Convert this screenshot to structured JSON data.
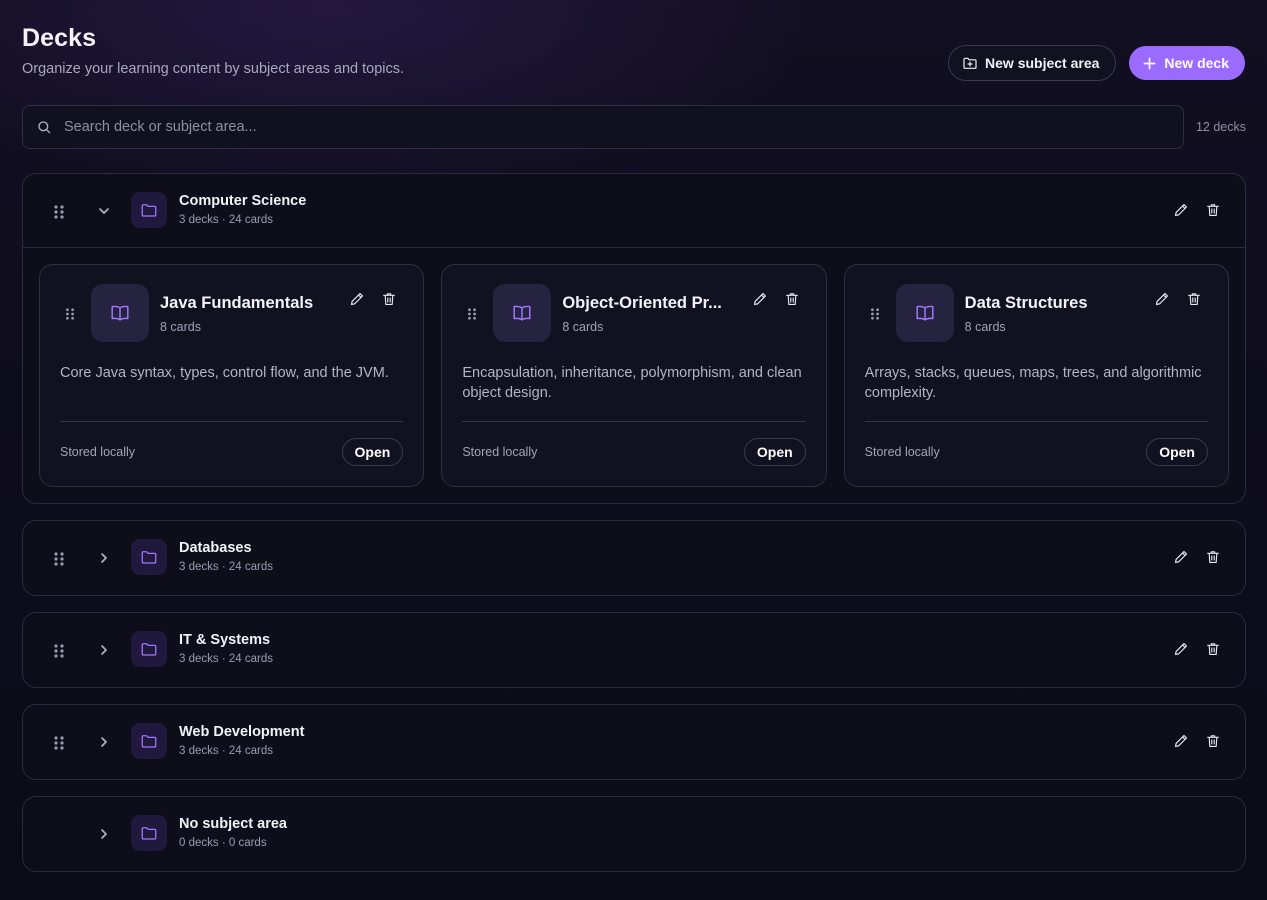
{
  "header": {
    "title": "Decks",
    "subtitle": "Organize your learning content by subject areas and topics.",
    "new_subject_label": "New subject area",
    "new_deck_label": "New deck"
  },
  "search": {
    "placeholder": "Search deck or subject area...",
    "value": "",
    "count_label": "12 decks"
  },
  "colors": {
    "accent": "#9b6bff",
    "background": "#0d0c1b",
    "panel": "#0e0d1a"
  },
  "icons": {
    "folder": "folder-icon",
    "book": "book-open-icon",
    "edit": "pencil-icon",
    "delete": "trash-icon",
    "drag": "grip-vertical-icon",
    "expand": "chevron-icon",
    "search": "search-icon",
    "plus": "plus-icon"
  },
  "groups": [
    {
      "name": "Computer Science",
      "meta": "3 decks · 24 cards",
      "expanded": true,
      "decks": [
        {
          "title": "Java Fundamentals",
          "count": "8 cards",
          "description": "Core Java syntax, types, control flow, and the JVM.",
          "footer": "Stored locally",
          "open_label": "Open"
        },
        {
          "title": "Object-Oriented Pr...",
          "count": "8 cards",
          "description": "Encapsulation, inheritance, polymorphism, and clean object design.",
          "footer": "Stored locally",
          "open_label": "Open"
        },
        {
          "title": "Data Structures",
          "count": "8 cards",
          "description": "Arrays, stacks, queues, maps, trees, and algorithmic complexity.",
          "footer": "Stored locally",
          "open_label": "Open"
        }
      ]
    },
    {
      "name": "Databases",
      "meta": "3 decks · 24 cards",
      "expanded": false
    },
    {
      "name": "IT & Systems",
      "meta": "3 decks · 24 cards",
      "expanded": false
    },
    {
      "name": "Web Development",
      "meta": "3 decks · 24 cards",
      "expanded": false
    },
    {
      "name": "No subject area",
      "meta": "0 decks · 0 cards",
      "expanded": false
    }
  ]
}
